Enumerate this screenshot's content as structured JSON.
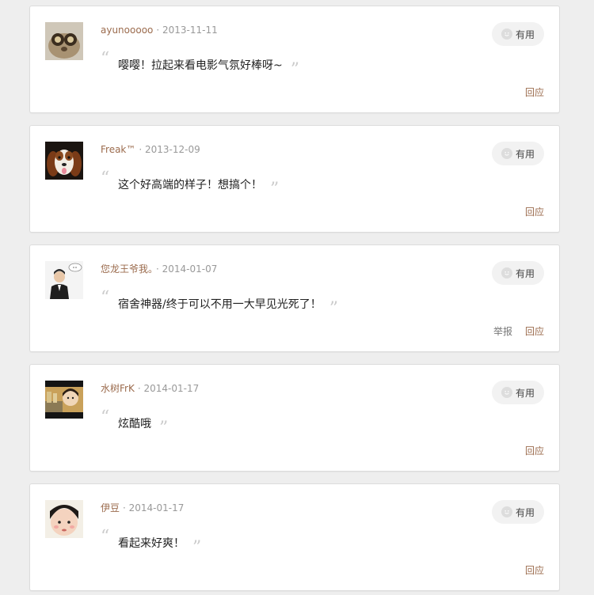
{
  "comments": [
    {
      "username": "ayunooooo",
      "date": "· 2013-11-11",
      "content": "嘤嘤！拉起来看电影气氛好棒呀~",
      "useful_label": "有用",
      "reply_label": "回应",
      "avatar_icon": "lemur-avatar"
    },
    {
      "username": "Freak™",
      "date": "· 2013-12-09",
      "content": "这个好高端的样子！想搞个！",
      "useful_label": "有用",
      "reply_label": "回应",
      "avatar_icon": "dog-avatar"
    },
    {
      "username": "您龙王爷我。",
      "date": "· 2014-01-07",
      "content": "宿舍神器/终于可以不用一大早见光死了！",
      "useful_label": "有用",
      "report_label": "举报",
      "reply_label": "回应",
      "avatar_icon": "suit-man-avatar"
    },
    {
      "username": "水树FrK",
      "date": "· 2014-01-17",
      "content": "炫酷哦",
      "useful_label": "有用",
      "reply_label": "回应",
      "avatar_icon": "child-avatar"
    },
    {
      "username": "伊豆",
      "date": "· 2014-01-17",
      "content": "看起来好爽！",
      "useful_label": "有用",
      "reply_label": "回应",
      "avatar_icon": "kid-avatar"
    }
  ]
}
